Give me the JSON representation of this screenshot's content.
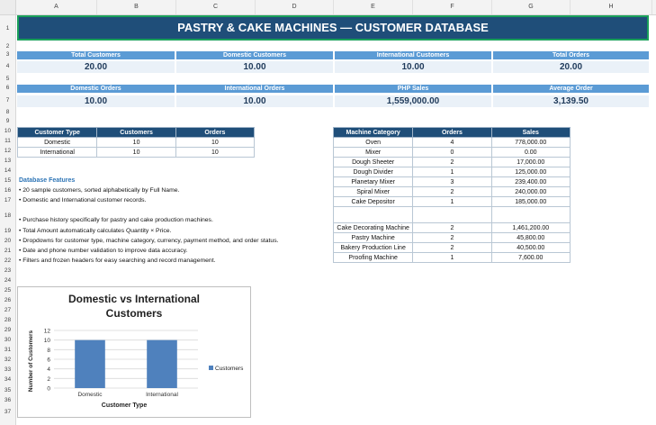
{
  "columns": [
    "A",
    "B",
    "C",
    "D",
    "E",
    "F",
    "G",
    "H"
  ],
  "rows": [
    "1",
    "2",
    "3",
    "4",
    "5",
    "6",
    "7",
    "8",
    "9",
    "10",
    "11",
    "12",
    "13",
    "14",
    "15",
    "16",
    "17",
    "18",
    "19",
    "20",
    "21",
    "22",
    "23",
    "24",
    "25",
    "26",
    "27",
    "28",
    "29",
    "30",
    "31",
    "32",
    "33",
    "34",
    "35",
    "36",
    "37"
  ],
  "title": "PASTRY & CAKE MACHINES — CUSTOMER DATABASE",
  "kpi_row1": [
    {
      "label": "Total Customers",
      "value": "20.00"
    },
    {
      "label": "Domestic Customers",
      "value": "10.00"
    },
    {
      "label": "International Customers",
      "value": "10.00"
    },
    {
      "label": "Total Orders",
      "value": "20.00"
    }
  ],
  "kpi_row2": [
    {
      "label": "Domestic Orders",
      "value": "10.00"
    },
    {
      "label": "International Orders",
      "value": "10.00"
    },
    {
      "label": "PHP Sales",
      "value": "1,559,000.00"
    },
    {
      "label": "Average Order",
      "value": "3,139.50"
    }
  ],
  "customer_table": {
    "headers": [
      "Customer Type",
      "Customers",
      "Orders"
    ],
    "rows": [
      [
        "Domestic",
        "10",
        "10"
      ],
      [
        "International",
        "10",
        "10"
      ]
    ]
  },
  "machine_table": {
    "headers": [
      "Machine Category",
      "Orders",
      "Sales"
    ],
    "rows": [
      [
        "Oven",
        "4",
        "778,000.00"
      ],
      [
        "Mixer",
        "0",
        "0.00"
      ],
      [
        "Dough Sheeter",
        "2",
        "17,000.00"
      ],
      [
        "Dough Divider",
        "1",
        "125,000.00"
      ],
      [
        "Planetary Mixer",
        "3",
        "239,400.00"
      ],
      [
        "Spiral Mixer",
        "2",
        "240,000.00"
      ],
      [
        "Cake Depositor",
        "1",
        "185,000.00"
      ],
      [
        "Cake Decorating Machine",
        "2",
        "1,461,200.00"
      ],
      [
        "Pastry Machine",
        "2",
        "45,800.00"
      ],
      [
        "Bakery Production Line",
        "2",
        "40,500.00"
      ],
      [
        "Proofing Machine",
        "1",
        "7,600.00"
      ]
    ]
  },
  "features": {
    "title": "Database Features",
    "items": [
      "• 20 sample customers, sorted alphabetically by Full Name.",
      "• Domestic and International customer records.",
      "• Purchase history specifically for pastry and cake production machines.",
      "• Total Amount automatically calculates Quantity × Price.",
      "• Dropdowns for customer type, machine category, currency, payment method, and order status.",
      "• Date and phone number validation to improve data accuracy.",
      "• Filters and frozen headers for easy searching and record management."
    ]
  },
  "colors": {
    "header_bg": "#1f4e79",
    "kpi_bar": "#5b9bd5",
    "bar": "#4f81bd",
    "selection": "#1aa05a"
  },
  "chart_data": {
    "type": "bar",
    "title_line1": "Domestic vs International",
    "title_line2": "Customers",
    "categories": [
      "Domestic",
      "International"
    ],
    "series": [
      {
        "name": "Customers",
        "values": [
          10,
          10
        ]
      }
    ],
    "xlabel": "Customer Type",
    "ylabel": "Number of Customers",
    "ylim": [
      0,
      12
    ],
    "yticks": [
      "0",
      "2",
      "4",
      "6",
      "8",
      "10",
      "12"
    ],
    "grid": true,
    "legend_position": "right"
  }
}
